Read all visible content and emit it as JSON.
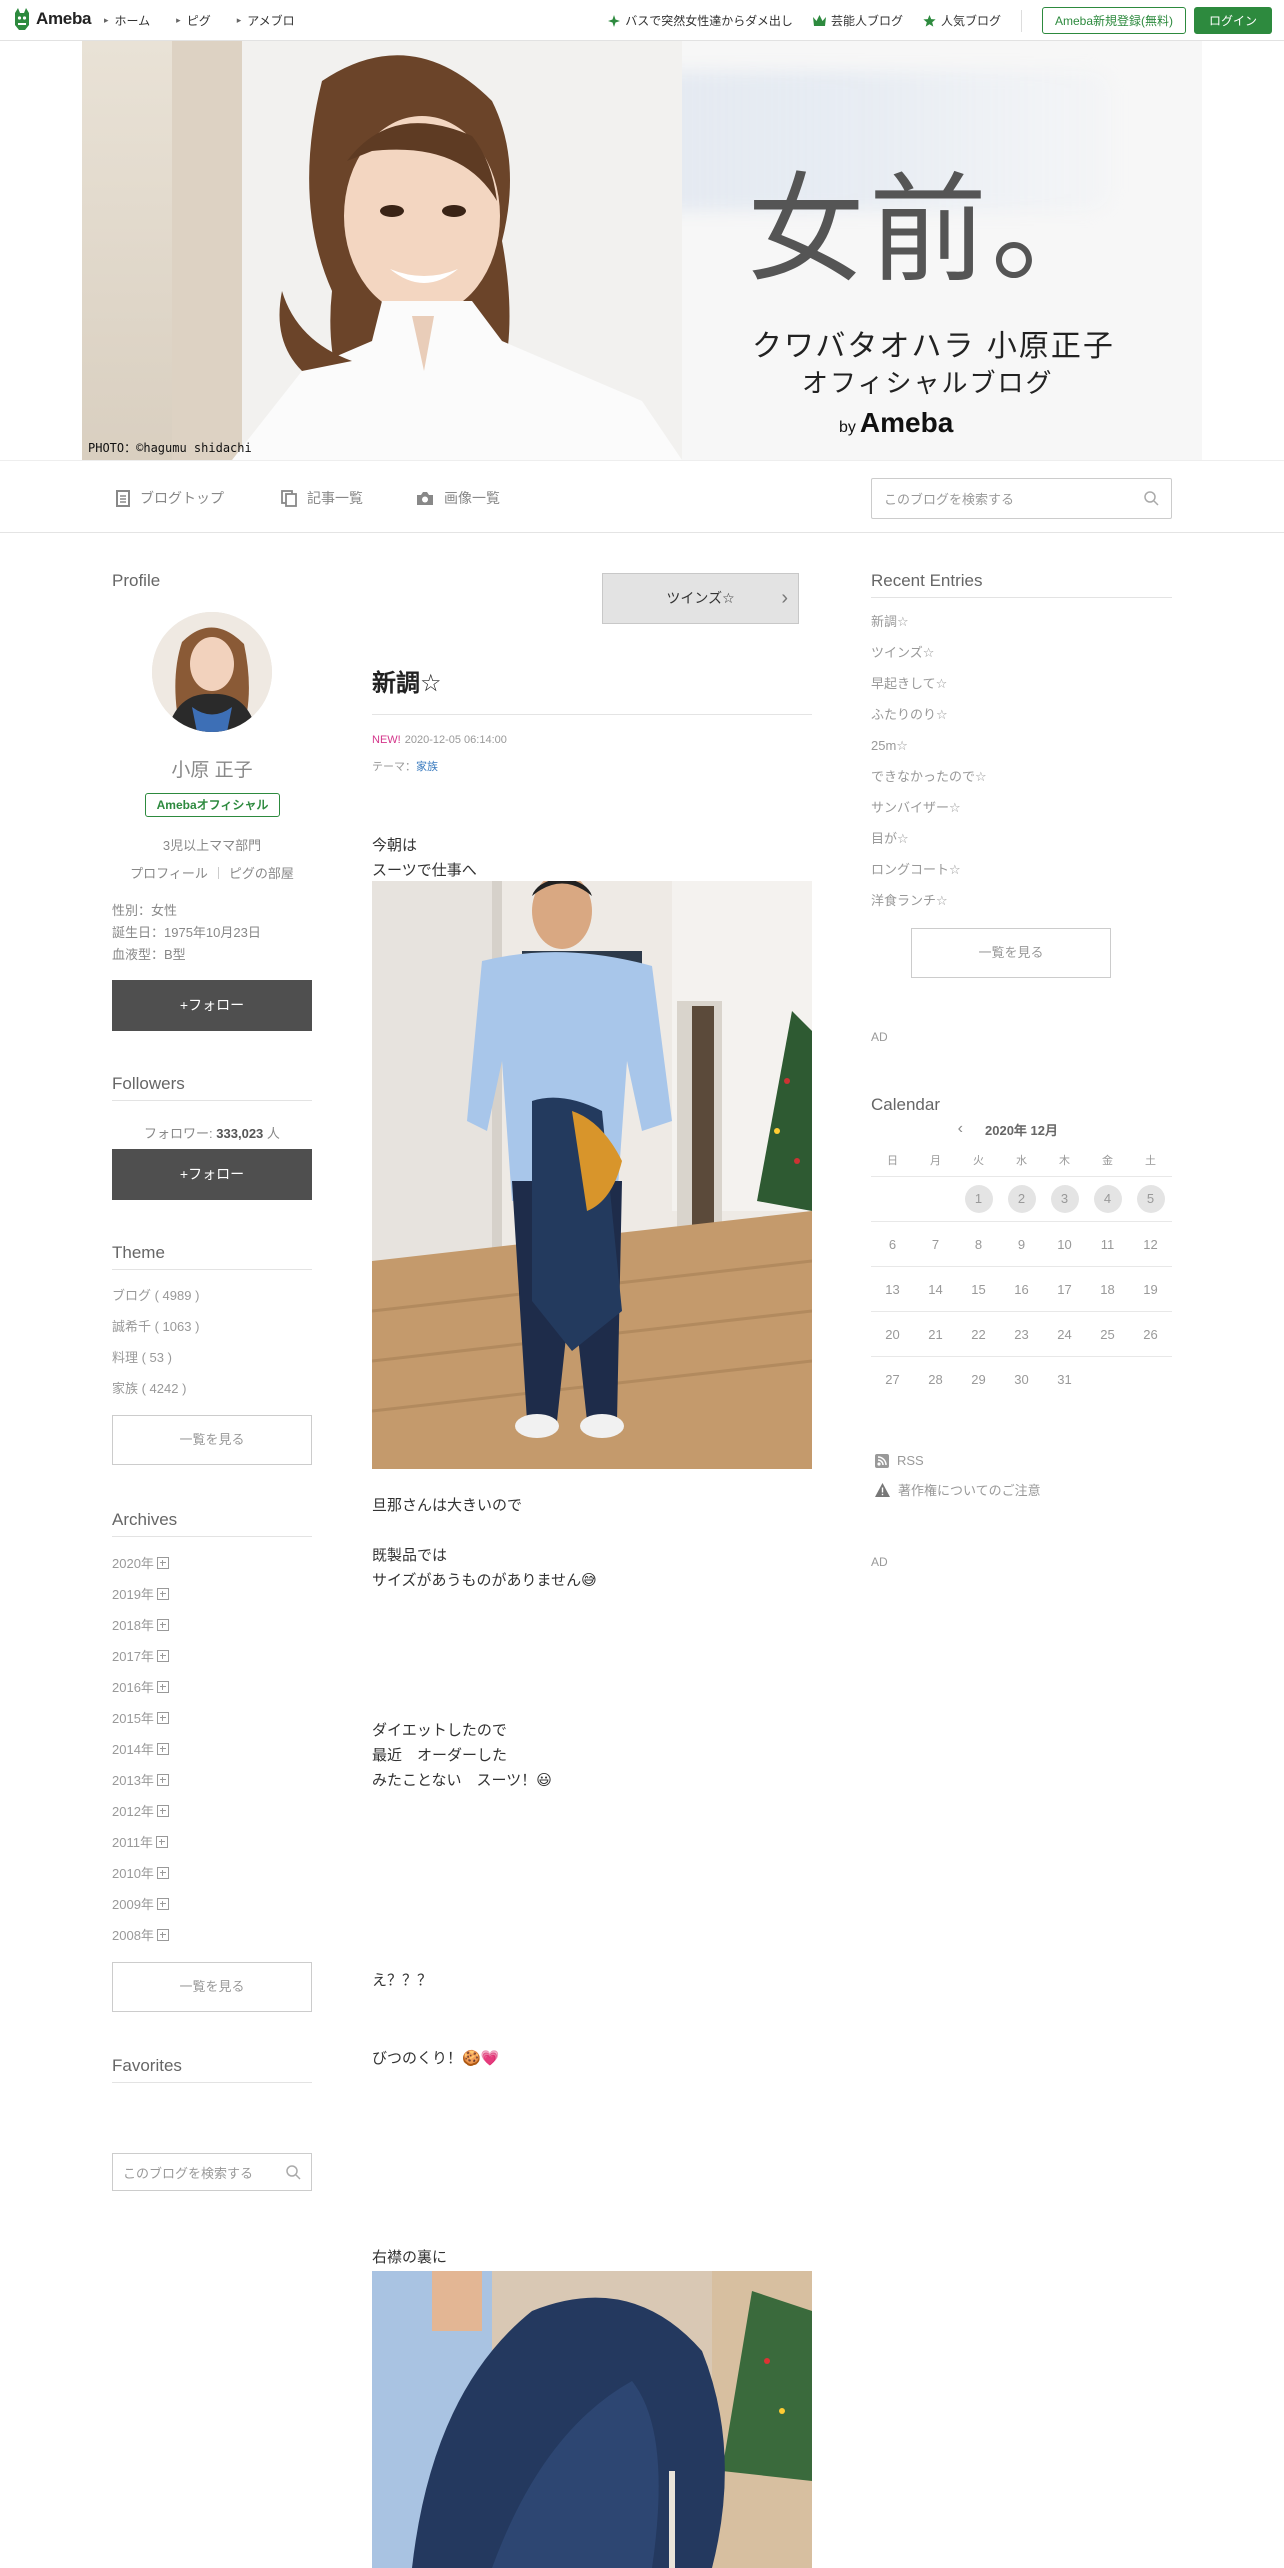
{
  "topbar": {
    "logo_text": "Ameba",
    "nav": [
      "ホーム",
      "ピグ",
      "アメブロ"
    ],
    "right_links": [
      "バスで突然女性達からダメ出し",
      "芸能人ブログ",
      "人気ブログ"
    ],
    "register_label": "Ameba新規登録(無料)",
    "login_label": "ログイン"
  },
  "header": {
    "photo_credit": "PHOTO：©hagumu shidachi",
    "title": "女前。",
    "subtitle_1": "クワバタオハラ 小原正子",
    "subtitle_2": "オフィシャルブログ",
    "by_prefix": "by",
    "by_brand": "Ameba"
  },
  "blognav": {
    "items": [
      "ブログトップ",
      "記事一覧",
      "画像一覧"
    ],
    "search_placeholder": "このブログを検索する"
  },
  "profile": {
    "section_title": "Profile",
    "name": "小原 正子",
    "badge": "Amebaオフィシャル",
    "description": "3児以上ママ部門",
    "links": [
      "プロフィール",
      "ピグの部屋"
    ],
    "info": [
      "性別：女性",
      "誕生日：1975年10月23日",
      "血液型：B型"
    ],
    "follow_label": "+フォロー"
  },
  "followers": {
    "section_title": "Followers",
    "prefix": "フォロワー:",
    "count": "333,023",
    "suffix": "人",
    "follow_label": "+フォロー"
  },
  "theme": {
    "section_title": "Theme",
    "items": [
      "ブログ ( 4989 )",
      "誠希千 ( 1063 )",
      "料理 ( 53 )",
      "家族 ( 4242 )"
    ],
    "more_label": "一覧を見る"
  },
  "archives": {
    "section_title": "Archives",
    "years": [
      "2020年",
      "2019年",
      "2018年",
      "2017年",
      "2016年",
      "2015年",
      "2014年",
      "2013年",
      "2012年",
      "2011年",
      "2010年",
      "2009年",
      "2008年"
    ],
    "more_label": "一覧を見る"
  },
  "favorites": {
    "section_title": "Favorites",
    "search_placeholder": "このブログを検索する"
  },
  "entry": {
    "prev_label": "ツインズ☆",
    "title": "新調☆",
    "new_label": "NEW!",
    "date": "2020-12-05 06:14:00",
    "theme_prefix": "テーマ：",
    "theme": "家族",
    "p1": [
      "今朝は",
      "スーツで仕事へ"
    ],
    "p2": [
      "旦那さんは大きいので"
    ],
    "p3": [
      "既製品では",
      "サイズがあうものがありません😅"
    ],
    "p4": [
      "ダイエットしたので",
      "最近　オーダーした",
      "みたことない　スーツ！😃"
    ],
    "p5": [
      "え？？？"
    ],
    "p6": [
      "びつのくり！🍪💗"
    ],
    "p7": [
      "右襟の裏に"
    ]
  },
  "recent": {
    "section_title": "Recent Entries",
    "items": [
      "新調☆",
      "ツインズ☆",
      "早起きして☆",
      "ふたりのり☆",
      "25m☆",
      "できなかったので☆",
      "サンバイザー☆",
      "目が☆",
      "ロングコート☆",
      "洋食ランチ☆"
    ],
    "more_label": "一覧を見る"
  },
  "ad_label": "AD",
  "calendar": {
    "section_title": "Calendar",
    "month": "2020年 12月",
    "weekdays": [
      "日",
      "月",
      "火",
      "水",
      "木",
      "金",
      "土"
    ],
    "weeks": [
      [
        "",
        "",
        "1",
        "2",
        "3",
        "4",
        "5"
      ],
      [
        "6",
        "7",
        "8",
        "9",
        "10",
        "11",
        "12"
      ],
      [
        "13",
        "14",
        "15",
        "16",
        "17",
        "18",
        "19"
      ],
      [
        "20",
        "21",
        "22",
        "23",
        "24",
        "25",
        "26"
      ],
      [
        "27",
        "28",
        "29",
        "30",
        "31",
        "",
        ""
      ]
    ]
  },
  "footer_links": {
    "rss": "RSS",
    "copyright": "著作権についてのご注意"
  },
  "colors": {
    "brand_green": "#2d8a3e",
    "follow_button": "#4f4f4f",
    "new_pink": "#d4368b",
    "theme_link": "#3a7bbf"
  }
}
